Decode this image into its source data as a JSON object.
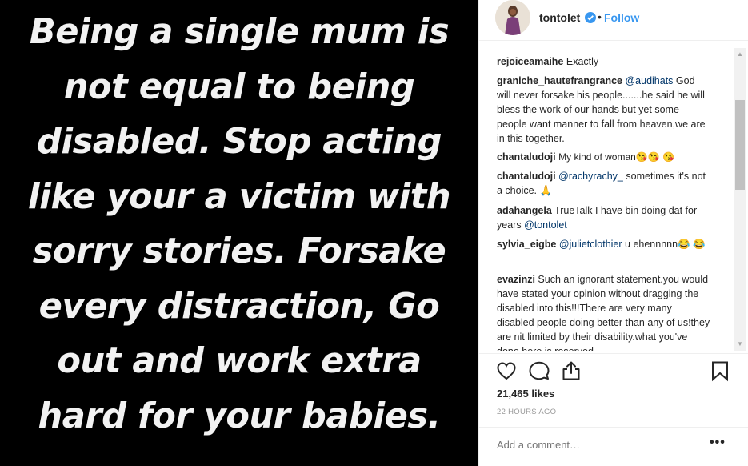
{
  "post": {
    "image_text": "Being a single mum is\nnot equal to being\ndisabled. Stop acting\nlike your a victim with\nsorry stories. Forsake\nevery distraction, Go\nout and work extra\nhard for your babies."
  },
  "header": {
    "username": "tontolet",
    "separator": "•",
    "follow_label": "Follow"
  },
  "comments": [
    {
      "user": "rejoiceamaihe",
      "text": "Exactly"
    },
    {
      "user": "graniche_hautefrangrance",
      "mention": "@audihats",
      "text": "God will never forsake his people.......he said he will bless the work of our hands but yet some people want manner to fall from heaven,we are in this together."
    },
    {
      "user": "chantaludoji",
      "text": "My kind of woman😘😘 😘"
    },
    {
      "user": "chantaludoji",
      "mention": "@rachyrachy_",
      "text": "sometimes it's not a choice. 🙏"
    },
    {
      "user": "adahangela",
      "text": "TrueTalk I have bin doing dat for years",
      "mention_after": "@tontolet"
    },
    {
      "user": "sylvia_eigbe",
      "mention": "@julietclothier",
      "text": "u ehennnnn😂 😂"
    },
    {
      "user": "evazinzi",
      "text": "Such an ignorant statement.you would have stated your opinion without dragging the disabled into this!!!There are very many disabled people doing better than any of us!they are nit limited by their disability.what you've done here is reserved"
    }
  ],
  "likes": "21,465 likes",
  "timestamp": "22 HOURS AGO",
  "add_comment_placeholder": "Add a comment…",
  "more_options": "•••"
}
